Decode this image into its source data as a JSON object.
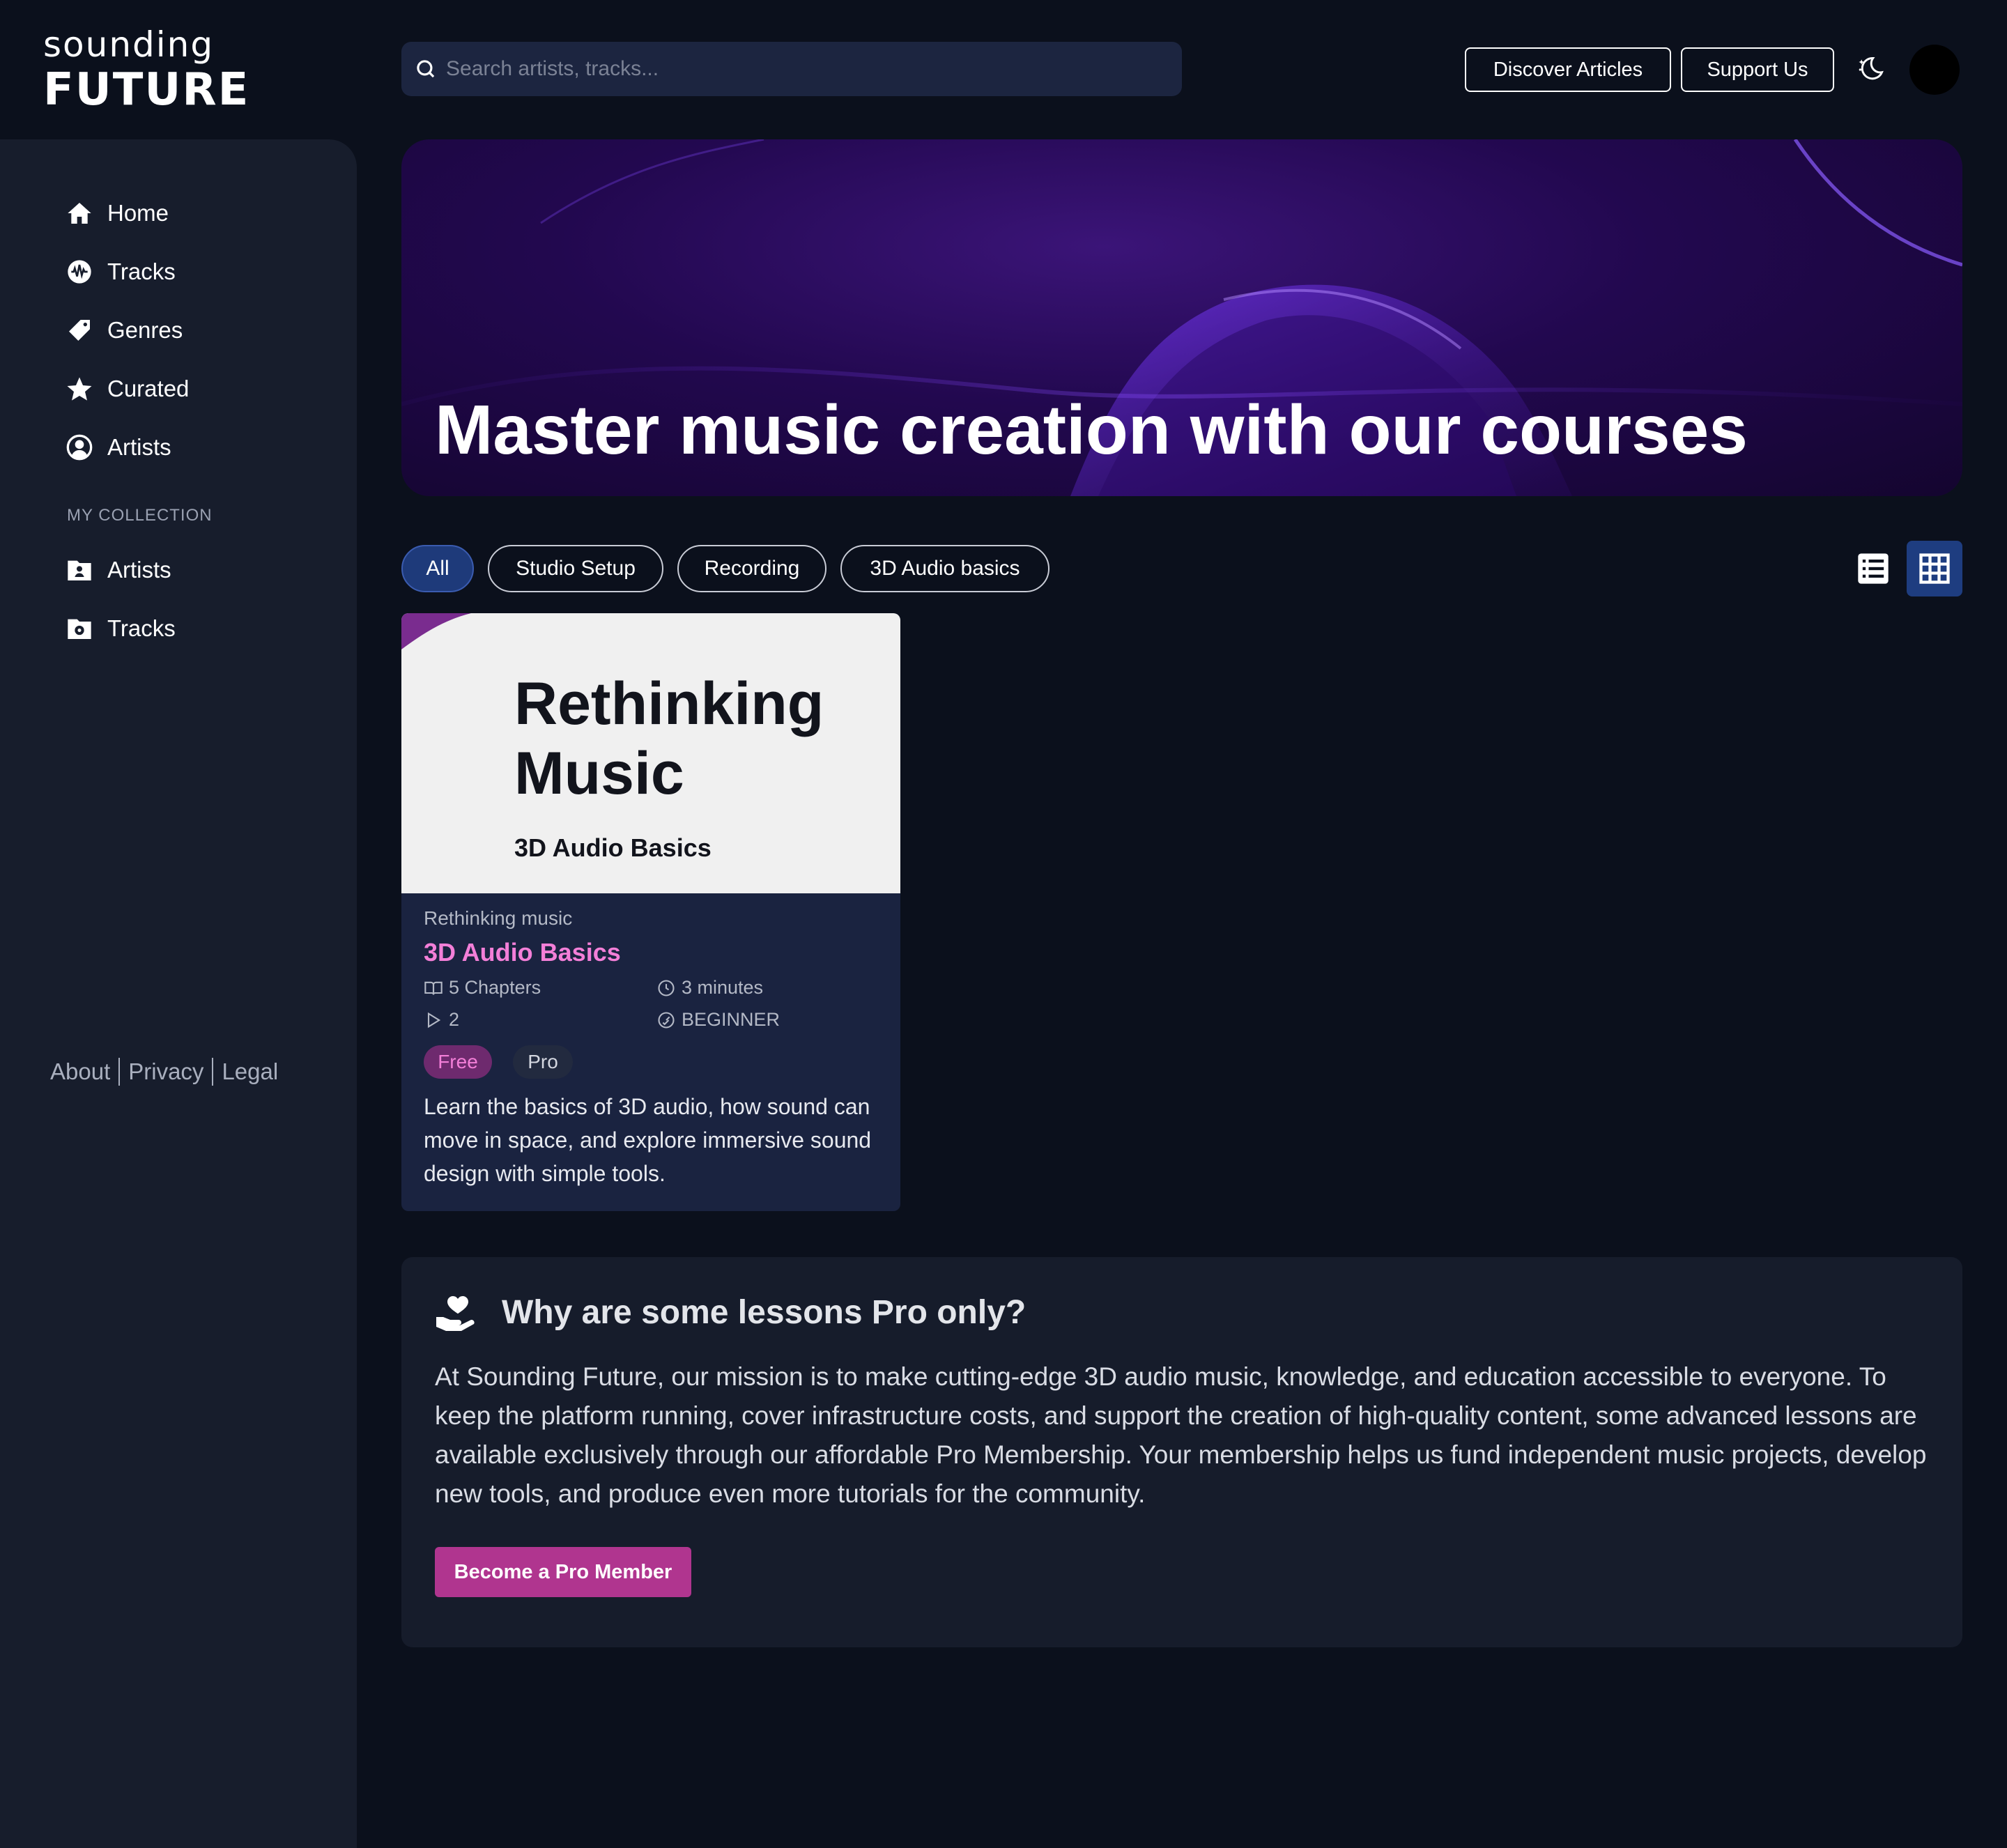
{
  "logo": {
    "top": "sounding",
    "bottom": "FUTURE"
  },
  "search": {
    "placeholder": "Search artists, tracks..."
  },
  "header": {
    "articles_label": "Discover Articles",
    "support_label": "Support Us"
  },
  "sidebar": {
    "items": [
      {
        "label": "Home",
        "icon": "home-icon"
      },
      {
        "label": "Tracks",
        "icon": "waveform-icon"
      },
      {
        "label": "Genres",
        "icon": "tag-icon"
      },
      {
        "label": "Curated",
        "icon": "star-icon"
      },
      {
        "label": "Artists",
        "icon": "user-circle-icon"
      }
    ],
    "collection_label": "MY COLLECTION",
    "collection_items": [
      {
        "label": "Artists",
        "icon": "user-folder-icon"
      },
      {
        "label": "Tracks",
        "icon": "music-folder-icon"
      }
    ],
    "footer": {
      "about": "About",
      "privacy": "Privacy",
      "legal": "Legal"
    }
  },
  "hero": {
    "title": "Master music creation with our courses"
  },
  "filters": {
    "chips": [
      "All",
      "Studio Setup",
      "Recording",
      "3D Audio basics"
    ],
    "active": "All"
  },
  "view": {
    "mode": "grid"
  },
  "course": {
    "cover_title": "Rethinking Music",
    "cover_subtitle": "3D Audio Basics",
    "eyebrow": "Rethinking music",
    "title": "3D Audio Basics",
    "chapters": "5 Chapters",
    "duration": "3 minutes",
    "lessons": "2",
    "level": "BEGINNER",
    "tags": [
      "Free",
      "Pro"
    ],
    "description": "Learn the basics of 3D audio, how sound can move in space, and explore immersive sound design with simple tools."
  },
  "info": {
    "title": "Why are some lessons Pro only?",
    "body": "At Sounding Future, our mission is to make cutting-edge 3D audio music, knowledge, and education accessible to everyone. To keep the platform running, cover infrastructure costs, and support the creation of high-quality content, some advanced lessons are available exclusively through our affordable Pro Membership. Your membership helps us fund independent music projects, develop new tools, and produce even more tutorials for the community.",
    "button_label": "Become a Pro Member"
  },
  "colors": {
    "background": "#0b101c",
    "sidebar": "#171d2c",
    "accent_pink": "#f37fd8",
    "button_magenta": "#b0358f",
    "active_blue": "#1e3a7a"
  }
}
